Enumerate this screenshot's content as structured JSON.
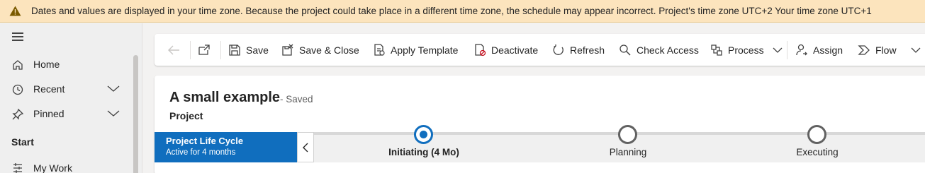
{
  "banner": {
    "message": "Dates and values are displayed in your time zone. Because the project could take place in a different time zone, the schedule may appear incorrect. Project's time zone UTC+2 Your time zone UTC+1",
    "icon": "warning-icon"
  },
  "sidebar": {
    "items": [
      {
        "label": "Home",
        "icon": "home-icon"
      },
      {
        "label": "Recent",
        "icon": "clock-icon"
      },
      {
        "label": "Pinned",
        "icon": "pin-icon"
      }
    ],
    "section_title": "Start",
    "section_items": [
      {
        "label": "My Work",
        "icon": "tasks-icon"
      }
    ]
  },
  "commands": {
    "save": "Save",
    "save_close": "Save & Close",
    "apply_template": "Apply Template",
    "deactivate": "Deactivate",
    "refresh": "Refresh",
    "check_access": "Check Access",
    "process": "Process",
    "assign": "Assign",
    "flow": "Flow"
  },
  "record": {
    "title": "A small example",
    "save_status": "- Saved",
    "entity": "Project"
  },
  "bpf": {
    "name": "Project Life Cycle",
    "status": "Active for 4 months",
    "stages": [
      {
        "label": "Initiating  (4 Mo)",
        "active": true
      },
      {
        "label": "Planning",
        "active": false
      },
      {
        "label": "Executing",
        "active": false
      }
    ]
  },
  "colors": {
    "accent": "#106ebe",
    "banner_bg": "#fce4bd",
    "stage_inactive": "#616161"
  }
}
